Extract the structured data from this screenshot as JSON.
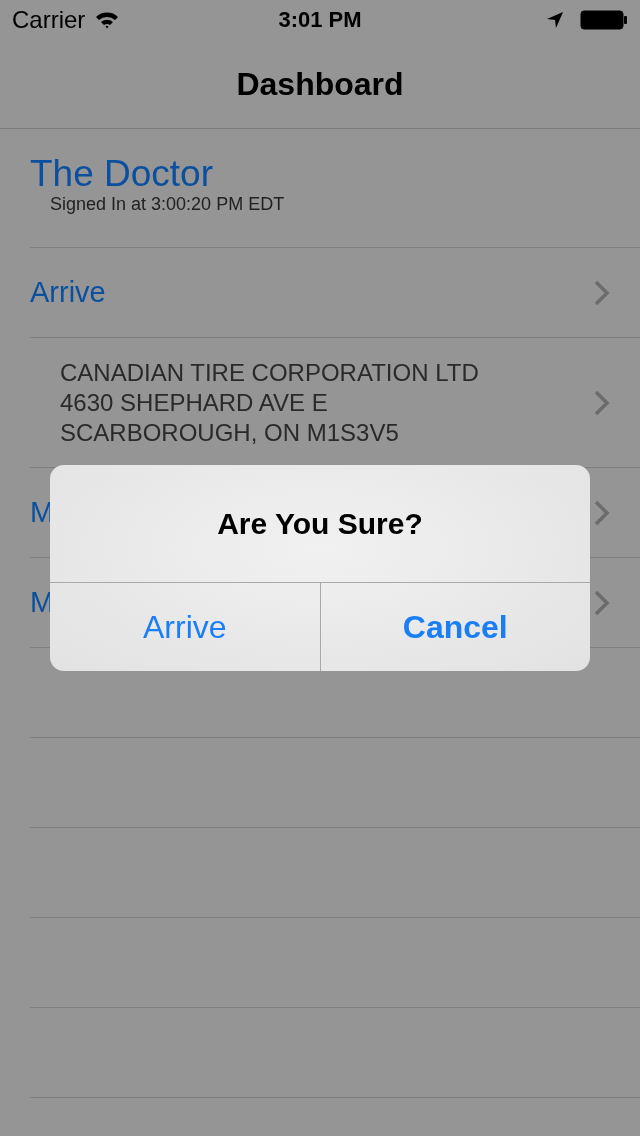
{
  "status_bar": {
    "carrier": "Carrier",
    "time": "3:01 PM"
  },
  "nav_bar": {
    "title": "Dashboard"
  },
  "user": {
    "name": "The Doctor",
    "subtitle": "Signed In at 3:00:20 PM EDT"
  },
  "rows": [
    {
      "kind": "action",
      "lines": [
        "Arrive"
      ]
    },
    {
      "kind": "address",
      "lines": [
        "CANADIAN TIRE CORPORATION LTD",
        "4630 SHEPHARD AVE E",
        "SCARBOROUGH, ON M1S3V5"
      ]
    },
    {
      "kind": "action",
      "lines": [
        "M"
      ]
    },
    {
      "kind": "action",
      "lines": [
        "M"
      ]
    }
  ],
  "alert": {
    "title": "Are You Sure?",
    "buttons": [
      {
        "label": "Arrive",
        "kind": "default"
      },
      {
        "label": "Cancel",
        "kind": "preferred"
      }
    ]
  }
}
